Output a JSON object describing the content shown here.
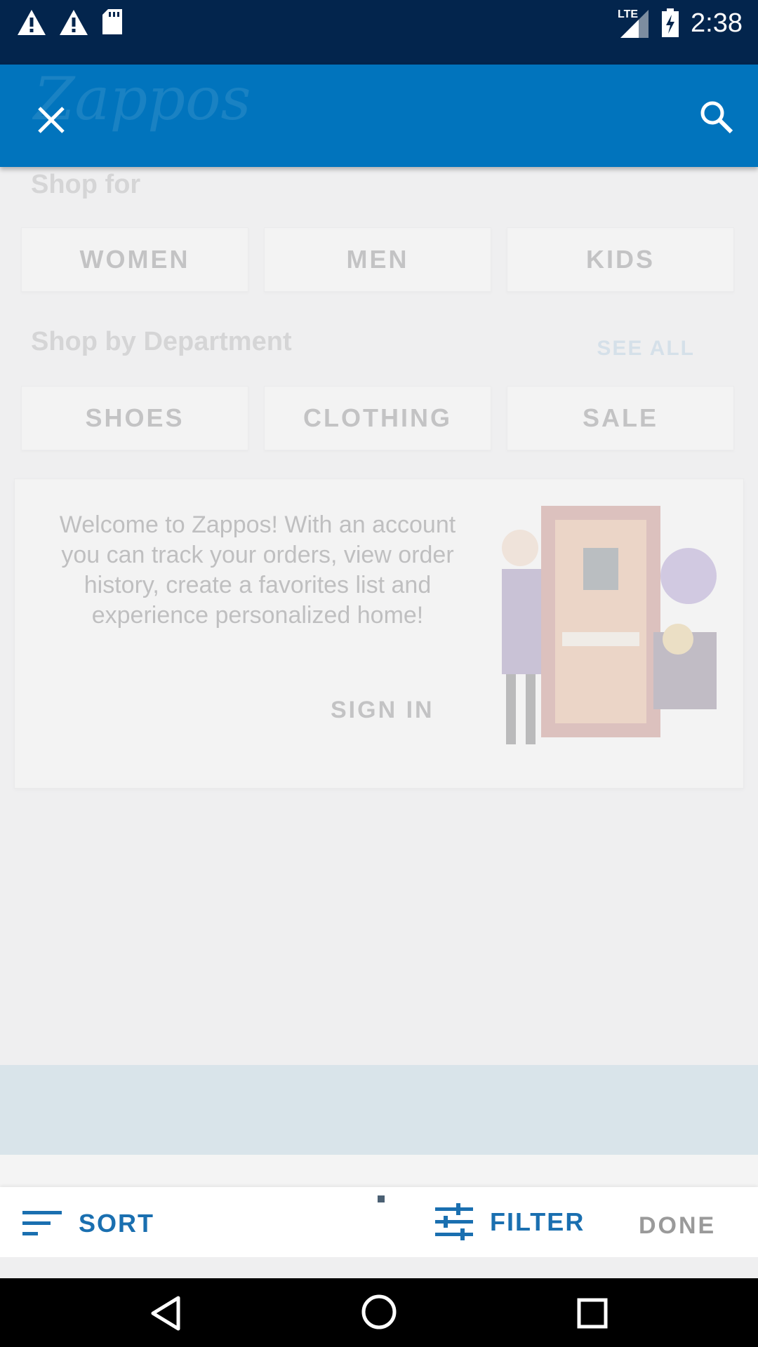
{
  "status_bar": {
    "time": "2:38",
    "network": "LTE",
    "icons": [
      "warning-icon",
      "warning-icon",
      "sd-card-icon",
      "signal-icon",
      "battery-charging-icon"
    ]
  },
  "app_bar": {
    "logo_text": "Zappos",
    "close_icon": "close-icon",
    "search_icon": "search-icon",
    "color": "#0174bd"
  },
  "background": {
    "shop_for_title": "Shop for",
    "shop_for_options": [
      "WOMEN",
      "MEN",
      "KIDS"
    ],
    "department_title": "Shop by Department",
    "department_see_all": "SEE ALL",
    "department_options": [
      "SHOES",
      "CLOTHING",
      "SALE"
    ],
    "welcome_text": "Welcome to Zappos! With an account you can track your orders, view order history, create a favorites list and experience personalized home!",
    "sign_in_label": "SIGN IN"
  },
  "sort_filter_bar": {
    "sort_label": "SORT",
    "filter_label": "FILTER",
    "done_label": "DONE",
    "accent_color": "#1a6fb0"
  },
  "nav_bar": {
    "icons": [
      "back-icon",
      "home-icon",
      "recents-icon"
    ]
  }
}
